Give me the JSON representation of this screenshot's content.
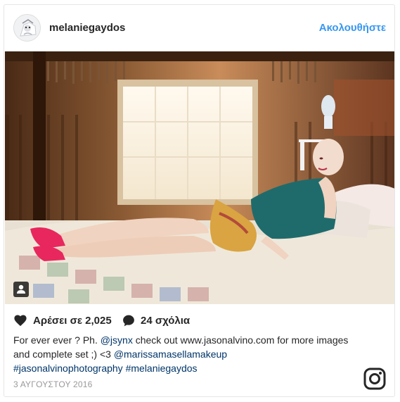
{
  "post": {
    "username": "melaniegaydos",
    "follow_label": "Ακολουθήστε",
    "likes_label": "Αρέσει σε 2,025",
    "comments_label": "24 σχόλια",
    "caption": {
      "part1": "For ever ever ? Ph. ",
      "mention1": "@jsynx",
      "part2": " check out www.jasonalvino.com for more images and complete set ;) <3 ",
      "mention2": "@marissamasellamakeup",
      "hashtag1": "#jasonalvinophotography",
      "hashtag2": "#melaniegaydos"
    },
    "date": "3 ΑΥΓΟΥΣΤΟΥ 2016"
  },
  "icons": {
    "avatar": "profile-avatar",
    "tag": "user-tag-icon",
    "like": "heart-icon",
    "comment": "comment-icon",
    "brand": "instagram-icon"
  },
  "colors": {
    "link": "#3897f0",
    "mention": "#003569",
    "text": "#262626",
    "muted": "#999999"
  }
}
